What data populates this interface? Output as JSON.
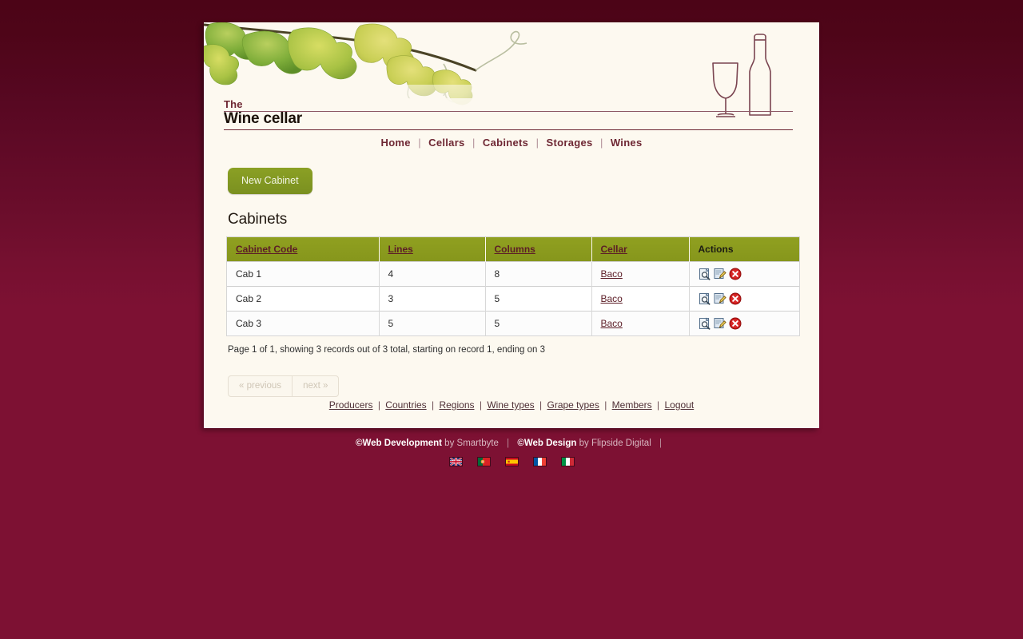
{
  "site": {
    "brand_prefix": "The",
    "brand_name": "Wine cellar"
  },
  "nav": {
    "separator": "|",
    "items": [
      {
        "label": "Home"
      },
      {
        "label": "Cellars"
      },
      {
        "label": "Cabinets"
      },
      {
        "label": "Storages"
      },
      {
        "label": "Wines"
      }
    ]
  },
  "toolbar": {
    "new_cabinet_label": "New Cabinet"
  },
  "main": {
    "page_title": "Cabinets",
    "table": {
      "columns": [
        {
          "label": "Cabinet Code",
          "sortable": true
        },
        {
          "label": "Lines",
          "sortable": true
        },
        {
          "label": "Columns",
          "sortable": true
        },
        {
          "label": "Cellar",
          "sortable": true
        },
        {
          "label": "Actions",
          "sortable": false
        }
      ],
      "rows": [
        {
          "code": "Cab 1",
          "lines": "4",
          "columns": "8",
          "cellar": "Baco"
        },
        {
          "code": "Cab 2",
          "lines": "3",
          "columns": "5",
          "cellar": "Baco"
        },
        {
          "code": "Cab 3",
          "lines": "5",
          "columns": "5",
          "cellar": "Baco"
        }
      ],
      "row_action_icons": [
        "view-icon",
        "edit-icon",
        "delete-icon"
      ]
    },
    "status_line": "Page 1 of 1, showing 3 records out of 3 total, starting on record 1, ending on 3",
    "pager": {
      "previous_label": "« previous",
      "next_label": "next »",
      "previous_disabled": true,
      "next_disabled": true
    }
  },
  "footer": {
    "separator": "|",
    "links": [
      {
        "label": "Producers"
      },
      {
        "label": "Countries"
      },
      {
        "label": "Regions"
      },
      {
        "label": "Wine types"
      },
      {
        "label": "Grape types"
      },
      {
        "label": "Members"
      },
      {
        "label": "Logout"
      }
    ]
  },
  "credits": {
    "copyright_mark": "©",
    "dev_strong": "Web Development",
    "dev_by": " by Smartbyte",
    "design_strong": "Web Design",
    "design_by": " by Flipside Digital",
    "separator": "|",
    "trailing_separator": "|"
  },
  "languages": [
    {
      "name": "english-flag",
      "title": "English"
    },
    {
      "name": "portuguese-flag",
      "title": "Português"
    },
    {
      "name": "spanish-flag",
      "title": "Español"
    },
    {
      "name": "french-flag",
      "title": "Français"
    },
    {
      "name": "italian-flag",
      "title": "Italiano"
    }
  ],
  "colors": {
    "background_top": "#4c0417",
    "background_bottom": "#7d1133",
    "panel": "#fdf9f0",
    "accent_green": "#8a9a1e",
    "link_maroon": "#5c1d26",
    "brand_maroon": "#6e2733"
  }
}
